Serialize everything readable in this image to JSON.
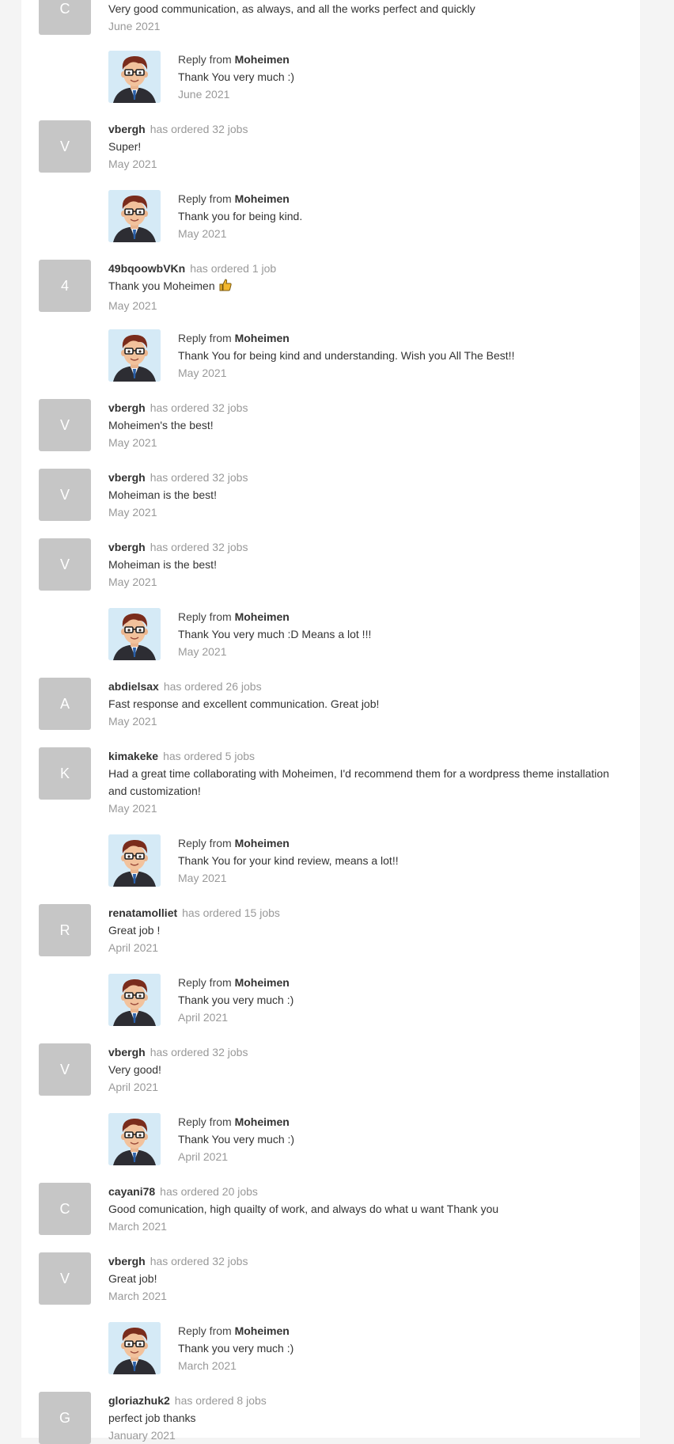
{
  "reply_prefix": "Reply from",
  "replier_name": "Moheimen",
  "entries": [
    {
      "type": "review",
      "avatar_letter": "C",
      "text": "Very good communication, as always, and all the works perfect and quickly",
      "date": "June 2021"
    },
    {
      "type": "reply",
      "text": "Thank You very much :)",
      "date": "June 2021"
    },
    {
      "type": "review",
      "avatar_letter": "V",
      "username": "vbergh",
      "ordered": "has ordered 32 jobs",
      "text": "Super!",
      "date": "May 2021"
    },
    {
      "type": "reply",
      "text": "Thank you for being kind.",
      "date": "May 2021"
    },
    {
      "type": "review",
      "avatar_letter": "4",
      "username": "49bqoowbVKn",
      "ordered": "has ordered 1 job",
      "text": "Thank you Moheimen",
      "emoji": "thumbs-up-icon",
      "date": "May 2021"
    },
    {
      "type": "reply",
      "text": "Thank You for being kind and understanding. Wish you All The Best!!",
      "date": "May 2021"
    },
    {
      "type": "review",
      "avatar_letter": "V",
      "username": "vbergh",
      "ordered": "has ordered 32 jobs",
      "text": "Moheimen's the best!",
      "date": "May 2021"
    },
    {
      "type": "review",
      "avatar_letter": "V",
      "username": "vbergh",
      "ordered": "has ordered 32 jobs",
      "text": "Moheiman is the best!",
      "date": "May 2021"
    },
    {
      "type": "review",
      "avatar_letter": "V",
      "username": "vbergh",
      "ordered": "has ordered 32 jobs",
      "text": "Moheiman is the best!",
      "date": "May 2021"
    },
    {
      "type": "reply",
      "text": "Thank You very much :D Means a lot !!!",
      "date": "May 2021"
    },
    {
      "type": "review",
      "avatar_letter": "A",
      "username": "abdielsax",
      "ordered": "has ordered 26 jobs",
      "text": "Fast response and excellent communication. Great job!",
      "date": "May 2021"
    },
    {
      "type": "review",
      "avatar_letter": "K",
      "username": "kimakeke",
      "ordered": "has ordered 5 jobs",
      "text": "Had a great time collaborating with Moheimen, I'd recommend them for a wordpress theme installation and customization!",
      "date": "May 2021"
    },
    {
      "type": "reply",
      "text": "Thank You for your kind review, means a lot!!",
      "date": "May 2021"
    },
    {
      "type": "review",
      "avatar_letter": "R",
      "username": "renatamolliet",
      "ordered": "has ordered 15 jobs",
      "text": "Great job !",
      "date": "April 2021"
    },
    {
      "type": "reply",
      "text": "Thank you very much :)",
      "date": "April 2021"
    },
    {
      "type": "review",
      "avatar_letter": "V",
      "username": "vbergh",
      "ordered": "has ordered 32 jobs",
      "text": "Very good!",
      "date": "April 2021"
    },
    {
      "type": "reply",
      "text": "Thank You very much :)",
      "date": "April 2021"
    },
    {
      "type": "review",
      "avatar_letter": "C",
      "username": "cayani78",
      "ordered": "has ordered 20 jobs",
      "text": "Good comunication, high quailty of work, and always do what u want Thank you",
      "date": "March 2021"
    },
    {
      "type": "review",
      "avatar_letter": "V",
      "username": "vbergh",
      "ordered": "has ordered 32 jobs",
      "text": "Great job!",
      "date": "March 2021"
    },
    {
      "type": "reply",
      "text": "Thank you very much :)",
      "date": "March 2021"
    },
    {
      "type": "review",
      "avatar_letter": "G",
      "username": "gloriazhuk2",
      "ordered": "has ordered 8 jobs",
      "text": "perfect job thanks",
      "date": "January 2021"
    }
  ]
}
